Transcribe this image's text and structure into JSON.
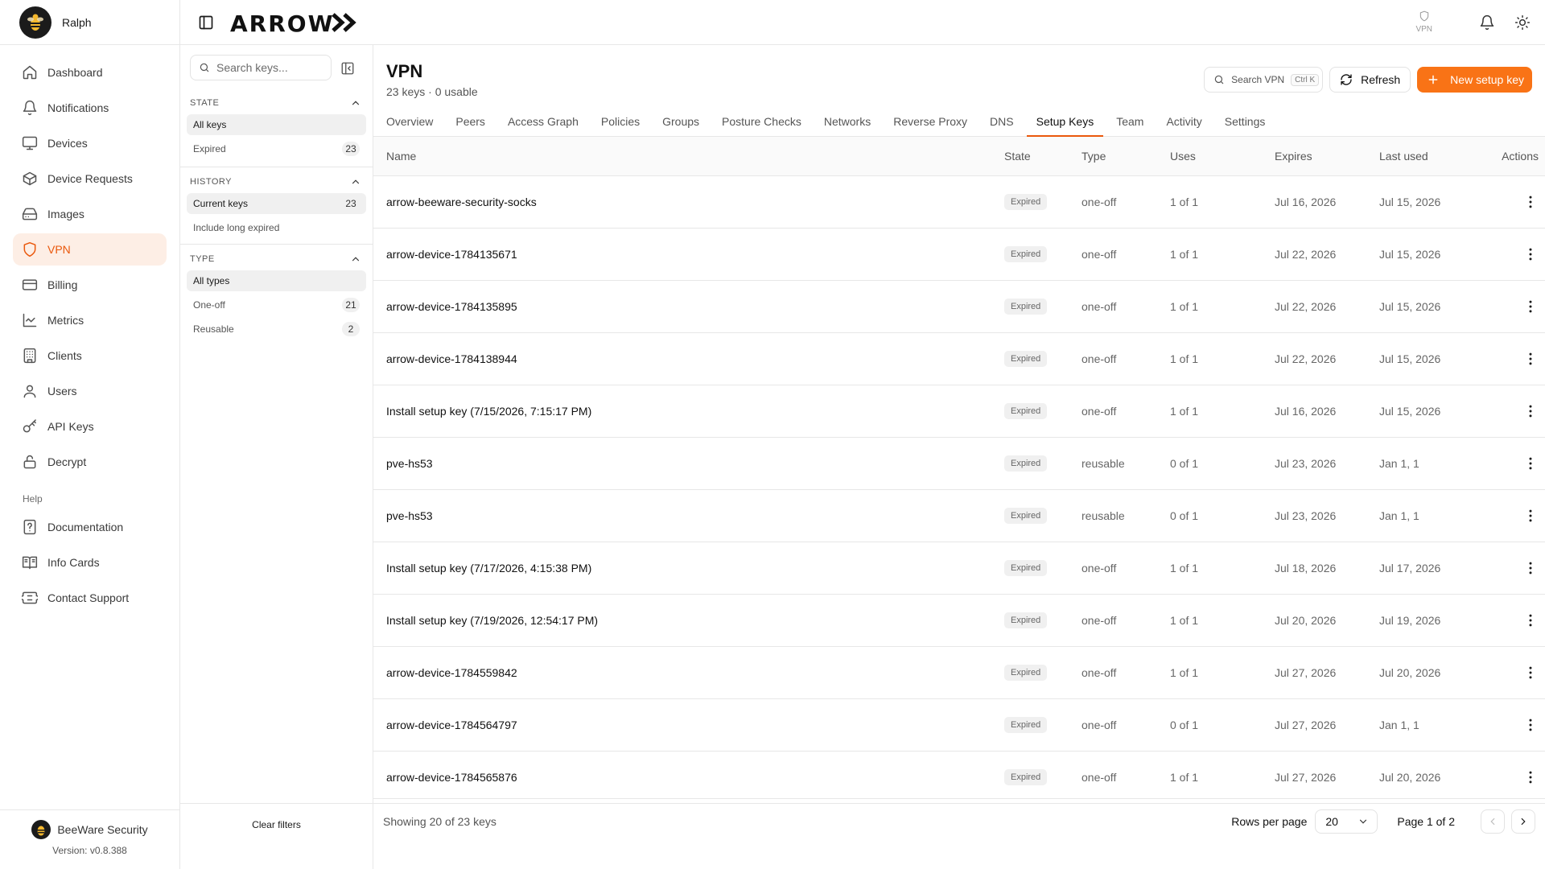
{
  "user": {
    "name": "Ralph"
  },
  "brand": {
    "logo_text": "ARROW"
  },
  "nav": {
    "items": [
      {
        "label": "Dashboard",
        "icon": "home-icon"
      },
      {
        "label": "Notifications",
        "icon": "bell-icon"
      },
      {
        "label": "Devices",
        "icon": "monitor-icon"
      },
      {
        "label": "Device Requests",
        "icon": "box-icon"
      },
      {
        "label": "Images",
        "icon": "drive-icon"
      },
      {
        "label": "VPN",
        "icon": "shield-icon",
        "active": true
      },
      {
        "label": "Billing",
        "icon": "credit-card-icon"
      },
      {
        "label": "Metrics",
        "icon": "chart-icon"
      },
      {
        "label": "Clients",
        "icon": "building-icon"
      },
      {
        "label": "Users",
        "icon": "user-icon"
      },
      {
        "label": "API Keys",
        "icon": "key-icon"
      },
      {
        "label": "Decrypt",
        "icon": "lock-icon"
      }
    ],
    "help_section": "Help",
    "help_items": [
      {
        "label": "Documentation",
        "icon": "help-file-icon"
      },
      {
        "label": "Info Cards",
        "icon": "book-icon"
      },
      {
        "label": "Contact Support",
        "icon": "ticket-icon"
      }
    ]
  },
  "org": {
    "name": "BeeWare Security",
    "version": "Version: v0.8.388"
  },
  "topbar": {
    "vpn_label": "VPN"
  },
  "filters": {
    "search_placeholder": "Search keys...",
    "state": {
      "title": "STATE",
      "options": [
        {
          "label": "All keys",
          "selected": true
        },
        {
          "label": "Expired",
          "count": "23"
        }
      ]
    },
    "history": {
      "title": "HISTORY",
      "options": [
        {
          "label": "Current keys",
          "count": "23",
          "selected": true
        },
        {
          "label": "Include long expired"
        }
      ]
    },
    "type": {
      "title": "TYPE",
      "options": [
        {
          "label": "All types",
          "selected": true
        },
        {
          "label": "One-off",
          "count": "21"
        },
        {
          "label": "Reusable",
          "count": "2"
        }
      ]
    },
    "clear_label": "Clear filters"
  },
  "page": {
    "title": "VPN",
    "subtitle": "23 keys · 0 usable",
    "search_label": "Search VPN",
    "search_shortcut": "Ctrl K",
    "refresh_label": "Refresh",
    "new_label": "New setup key"
  },
  "tabs": [
    "Overview",
    "Peers",
    "Access Graph",
    "Policies",
    "Groups",
    "Posture Checks",
    "Networks",
    "Reverse Proxy",
    "DNS",
    "Setup Keys",
    "Team",
    "Activity",
    "Settings"
  ],
  "active_tab": "Setup Keys",
  "table": {
    "headers": {
      "name": "Name",
      "state": "State",
      "type": "Type",
      "uses": "Uses",
      "expires": "Expires",
      "last_used": "Last used",
      "actions": "Actions"
    },
    "rows": [
      {
        "name": "arrow-beeware-security-socks",
        "state": "Expired",
        "type": "one-off",
        "uses": "1 of 1",
        "expires": "Jul 16, 2026",
        "last_used": "Jul 15, 2026"
      },
      {
        "name": "arrow-device-1784135671",
        "state": "Expired",
        "type": "one-off",
        "uses": "1 of 1",
        "expires": "Jul 22, 2026",
        "last_used": "Jul 15, 2026"
      },
      {
        "name": "arrow-device-1784135895",
        "state": "Expired",
        "type": "one-off",
        "uses": "1 of 1",
        "expires": "Jul 22, 2026",
        "last_used": "Jul 15, 2026"
      },
      {
        "name": "arrow-device-1784138944",
        "state": "Expired",
        "type": "one-off",
        "uses": "1 of 1",
        "expires": "Jul 22, 2026",
        "last_used": "Jul 15, 2026"
      },
      {
        "name": "Install setup key (7/15/2026, 7:15:17 PM)",
        "state": "Expired",
        "type": "one-off",
        "uses": "1 of 1",
        "expires": "Jul 16, 2026",
        "last_used": "Jul 15, 2026"
      },
      {
        "name": "pve-hs53",
        "state": "Expired",
        "type": "reusable",
        "uses": "0 of 1",
        "expires": "Jul 23, 2026",
        "last_used": "Jan 1, 1"
      },
      {
        "name": "pve-hs53",
        "state": "Expired",
        "type": "reusable",
        "uses": "0 of 1",
        "expires": "Jul 23, 2026",
        "last_used": "Jan 1, 1"
      },
      {
        "name": "Install setup key (7/17/2026, 4:15:38 PM)",
        "state": "Expired",
        "type": "one-off",
        "uses": "1 of 1",
        "expires": "Jul 18, 2026",
        "last_used": "Jul 17, 2026"
      },
      {
        "name": "Install setup key (7/19/2026, 12:54:17 PM)",
        "state": "Expired",
        "type": "one-off",
        "uses": "1 of 1",
        "expires": "Jul 20, 2026",
        "last_used": "Jul 19, 2026"
      },
      {
        "name": "arrow-device-1784559842",
        "state": "Expired",
        "type": "one-off",
        "uses": "1 of 1",
        "expires": "Jul 27, 2026",
        "last_used": "Jul 20, 2026"
      },
      {
        "name": "arrow-device-1784564797",
        "state": "Expired",
        "type": "one-off",
        "uses": "0 of 1",
        "expires": "Jul 27, 2026",
        "last_used": "Jan 1, 1"
      },
      {
        "name": "arrow-device-1784565876",
        "state": "Expired",
        "type": "one-off",
        "uses": "1 of 1",
        "expires": "Jul 27, 2026",
        "last_used": "Jul 20, 2026"
      }
    ]
  },
  "pagination": {
    "showing": "Showing 20 of 23 keys",
    "rows_per_page_label": "Rows per page",
    "rows_per_page_value": "20",
    "page_info": "Page 1 of 2"
  },
  "colors": {
    "accent": "#f97316",
    "accent_text": "#ea580c",
    "active_bg": "#fdeee5"
  }
}
